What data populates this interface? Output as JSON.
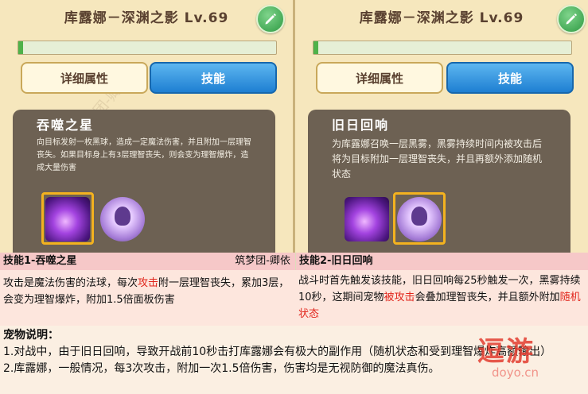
{
  "left_panel": {
    "title": "库露娜－深渊之影 Lv.69",
    "exp_progress": 0.02,
    "tab_detail": "详细属性",
    "tab_skill": "技能",
    "skill_name": "吞噬之星",
    "skill_desc": "向目标发射一枚黑球，造成一定魔法伤害，并且附加一层理智丧失。如果目标身上有3层理智丧失，则会变为理智爆炸，造成大量伤害"
  },
  "right_panel": {
    "title": "库露娜－深渊之影 Lv.69",
    "exp_progress": 0.02,
    "tab_detail": "详细属性",
    "tab_skill": "技能",
    "skill_name": "旧日回响",
    "skill_desc": "为库露娜召唤一层黑雾，黑雾持续时间内被攻击后将为目标附加一层理智丧失，并且再额外添加随机状态"
  },
  "skill1": {
    "header": "技能1-吞噬之星",
    "credit": "筑梦团-卿依",
    "text_a": "攻击是魔法伤害的法球，每次",
    "text_red": "攻击",
    "text_b": "附一层理智丧失，累加3层，会变为理智爆炸，附加1.5倍面板伤害"
  },
  "skill2": {
    "header": "技能2-旧日回响",
    "text_a": "战斗时首先触发该技能，旧日回响每25秒触发一次，黑雾持续10秒，这期间宠物",
    "text_red1": "被攻击",
    "text_b": "会叠加理智丧失，并且额外附加",
    "text_red2": "随机状态"
  },
  "notes": {
    "title": "宠物说明：",
    "line1": "1.对战中，由于旧日回响，导致开战前10秒击打库露娜会有极大的副作用（随机状态和受到理智爆炸高额输出）",
    "line2": "2.库露娜，一般情况，每3次攻击，附加一次1.5倍伤害，伤害均是无视防御的魔法真伤。"
  },
  "logo": {
    "big": "逗游",
    "small": "doyo.cn"
  },
  "watermark": "筑梦团-卿依",
  "icons": [
    "edit-pencil-icon",
    "dark-orb-skill-icon",
    "kuluna-bubble-skill-icon"
  ]
}
